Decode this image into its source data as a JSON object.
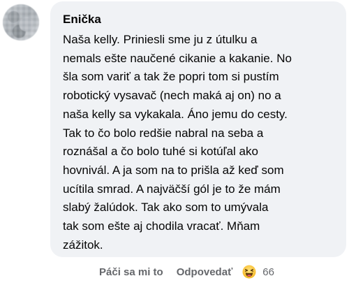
{
  "comment": {
    "author": "Enička",
    "lines": [
      "Naša kelly. Priniesli sme ju z útulku a",
      "nemals ešte naučené cikanie a kakanie. No",
      "šla som variť a tak že popri tom si pustím",
      "robotický vysavač (nech maká aj on) no a",
      "naša kelly sa vykakala. Áno jemu do cesty.",
      "Tak to čo bolo redšie nabral na seba a",
      "roznášal a čo bolo tuhé si kotúľal ako",
      "hovnivál. A ja som na to prišla až keď som",
      "ucítila smrad. A najväčší gól je to že mám",
      "slabý žalúdok. Tak ako som to umývala",
      "tak som ešte aj chodila vracať. Mňam",
      "zážitok."
    ]
  },
  "actions": {
    "like_label": "Páči sa mi to",
    "reply_label": "Odpovedať",
    "reaction_icon": "laughing-face-icon",
    "reaction_count": "66"
  },
  "colors": {
    "bubble_bg": "#f0f2f5",
    "text": "#050505",
    "secondary": "#65676b"
  }
}
